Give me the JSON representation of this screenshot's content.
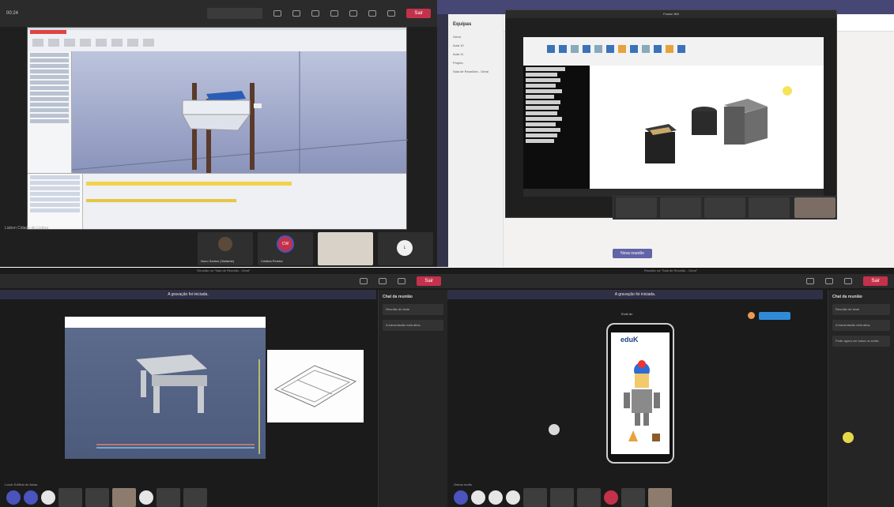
{
  "q1": {
    "timer": "00:24",
    "search_placeholder": "",
    "leave_label": "Sair",
    "participants": [
      {
        "name": "Nuno Santos (Visitante)",
        "initials": ""
      },
      {
        "name": "Cristina Pereira",
        "initials": "CW"
      },
      {
        "name": "",
        "initials": ""
      },
      {
        "name": "",
        "initials": "L"
      }
    ],
    "footer_text": "Lisbon Cidade de Lisboa"
  },
  "q2": {
    "window_title": "Fusion 360",
    "app": "Equipas",
    "nav": [
      "Actividade",
      "Chat",
      "Equipas",
      "Calendário"
    ],
    "teams": [
      "Geral",
      "Aula 10",
      "Aula 11",
      "Projeto",
      "Sala de Reuniões - Geral"
    ],
    "new_meeting_label": "Nova reunião",
    "participants": [
      "",
      "",
      "",
      "",
      ""
    ]
  },
  "q3": {
    "window_title": "Reunião na \"Sala de Reunião - Geral\"",
    "banner_text": "A gravação foi iniciada.",
    "chat_title": "Chat da reunião",
    "chat_messages": [
      "Reunião de teste",
      "A transmissão está ativa."
    ],
    "footer_text": "Local: Edifício de Aulas",
    "leave_label": "Sair"
  },
  "q4": {
    "window_title": "Reunião na \"Sala de Reunião - Geral\"",
    "banner_text": "A gravação foi iniciada.",
    "tab_title": "Ecrã de: ",
    "phone_logo": "eduK",
    "chat_title": "Chat da reunião",
    "chat_messages": [
      "Reunião de teste",
      "A transmissão está ativa.",
      "Pode agora ver todos os ecrãs"
    ],
    "leave_label": "Sair",
    "footer_text": "Outros ecrãs"
  }
}
